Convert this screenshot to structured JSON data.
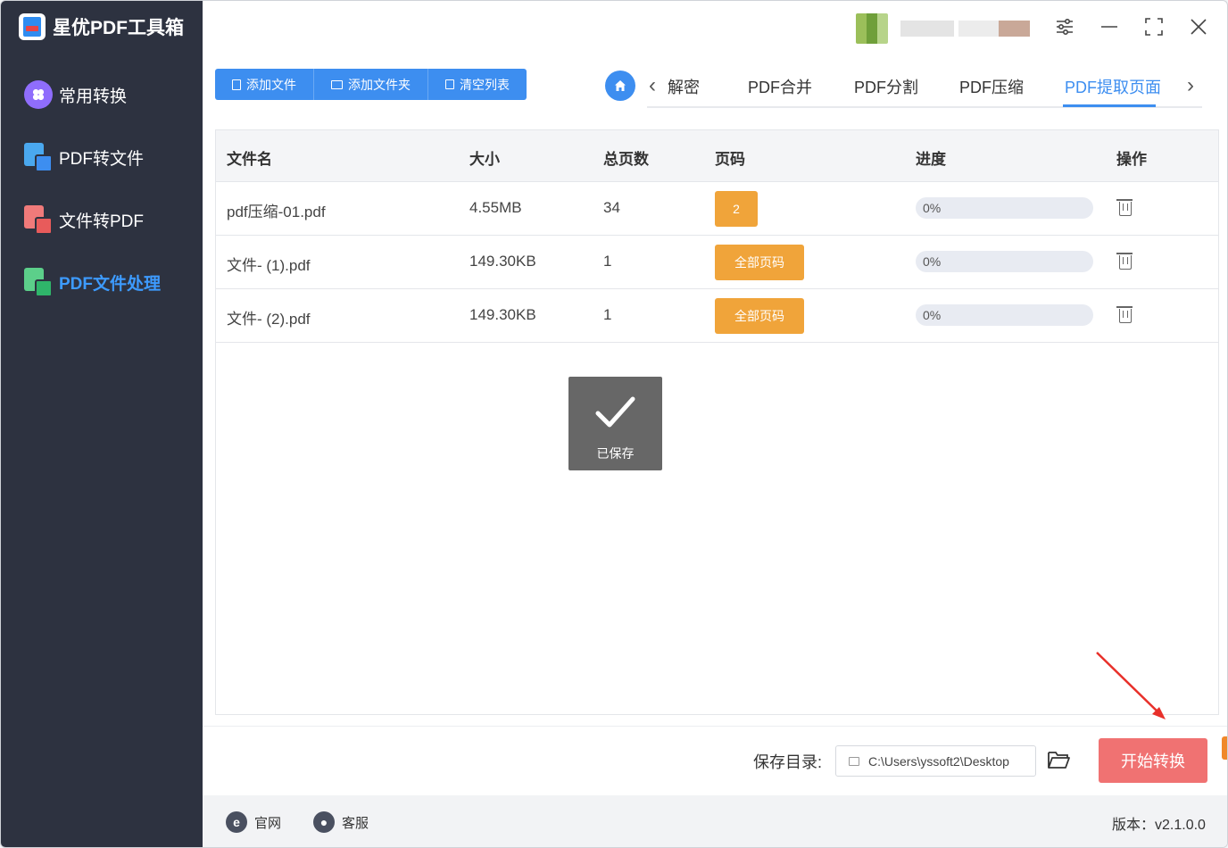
{
  "app": {
    "title": "星优PDF工具箱"
  },
  "sidebar": {
    "items": [
      {
        "label": "常用转换",
        "icon": "grid-circle-icon"
      },
      {
        "label": "PDF转文件",
        "icon": "pdf-to-file-icon"
      },
      {
        "label": "文件转PDF",
        "icon": "file-to-pdf-icon"
      },
      {
        "label": "PDF文件处理",
        "icon": "pdf-process-icon",
        "active": true
      }
    ]
  },
  "toolbar": {
    "add_file": "添加文件",
    "add_folder": "添加文件夹",
    "clear_list": "清空列表"
  },
  "tabs": {
    "items": [
      "解密",
      "PDF合并",
      "PDF分割",
      "PDF压缩",
      "PDF提取页面"
    ],
    "active": "PDF提取页面"
  },
  "table": {
    "headers": {
      "name": "文件名",
      "size": "大小",
      "pages": "总页数",
      "page_code": "页码",
      "progress": "进度",
      "action": "操作"
    },
    "rows": [
      {
        "name": "pdf压缩-01.pdf",
        "size": "4.55MB",
        "pages": "34",
        "page_code": "2",
        "progress_text": "0%",
        "progress": 0
      },
      {
        "name": "文件- (1).pdf",
        "size": "149.30KB",
        "pages": "1",
        "page_code": "全部页码",
        "progress_text": "0%",
        "progress": 0
      },
      {
        "name": "文件- (2).pdf",
        "size": "149.30KB",
        "pages": "1",
        "page_code": "全部页码",
        "progress_text": "0%",
        "progress": 0
      }
    ]
  },
  "toast": {
    "text": "已保存"
  },
  "output": {
    "label": "保存目录:",
    "path": "C:\\Users\\yssoft2\\Desktop",
    "start_button": "开始转换"
  },
  "footer": {
    "website": "官网",
    "support": "客服",
    "version": "版本：v2.1.0.0"
  },
  "colors": {
    "sidebar_bg": "#2d3240",
    "accent_blue": "#3d8ef0",
    "page_button": "#f0a43a",
    "start_button": "#f07272"
  }
}
